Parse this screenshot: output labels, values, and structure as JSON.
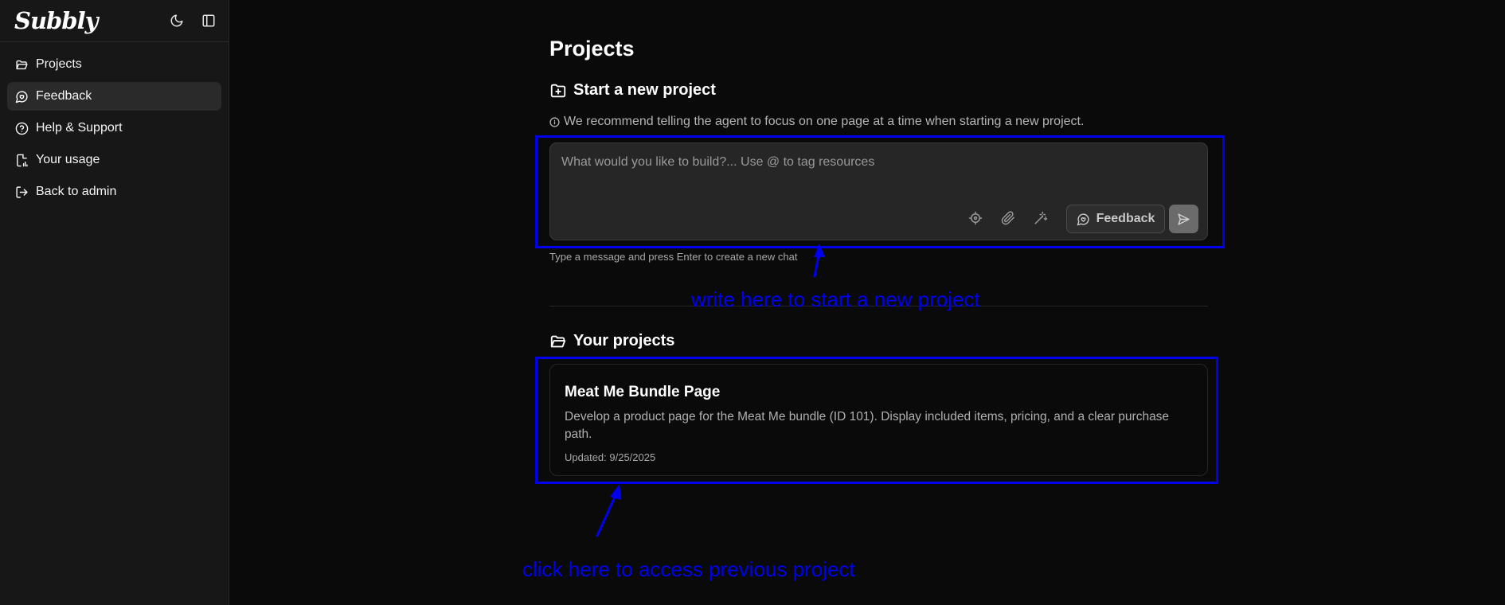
{
  "sidebar": {
    "logo": "Subbly",
    "items": [
      {
        "label": "Projects",
        "icon": "folder-open-icon"
      },
      {
        "label": "Feedback",
        "icon": "message-heart-icon",
        "active": true
      },
      {
        "label": "Help & Support",
        "icon": "help-circle-icon"
      },
      {
        "label": "Your usage",
        "icon": "usage-icon"
      },
      {
        "label": "Back to admin",
        "icon": "log-out-icon"
      }
    ]
  },
  "main": {
    "title": "Projects",
    "new_project": {
      "title": "Start a new project",
      "recommendation": "We recommend telling the agent to focus on one page at a time when starting a new project.",
      "placeholder": "What would you like to build?... Use @ to tag resources",
      "feedback_label": "Feedback",
      "hint": "Type a message and press Enter to create a new chat"
    },
    "your_projects": {
      "title": "Your projects",
      "items": [
        {
          "name": "Meat Me Bundle Page",
          "description": "Develop a product page for the Meat Me bundle (ID 101). Display included items, pricing, and a clear purchase path.",
          "updated": "Updated: 9/25/2025"
        }
      ]
    }
  },
  "annotations": {
    "composer_note": "write here to start a new project",
    "project_note": "click here to access previous project",
    "color": "#0000ee"
  }
}
